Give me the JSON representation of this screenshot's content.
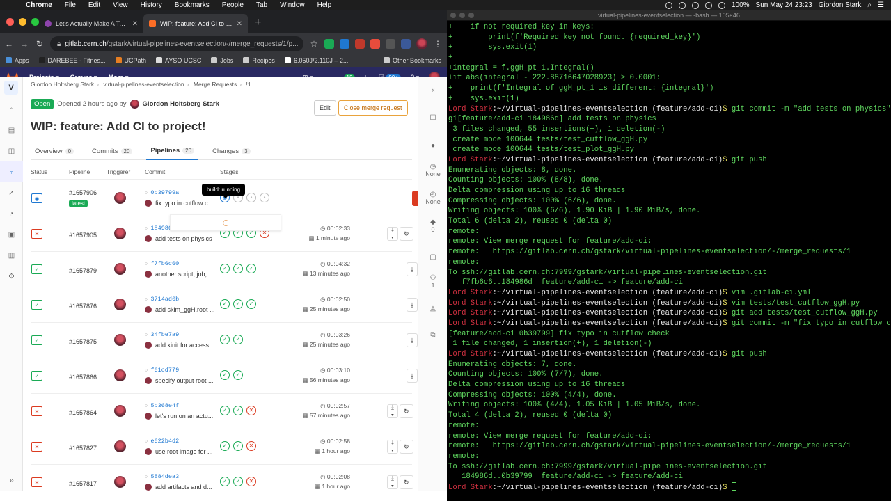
{
  "menubar": {
    "app": "Chrome",
    "items": [
      "File",
      "Edit",
      "View",
      "History",
      "Bookmarks",
      "People",
      "Tab",
      "Window",
      "Help"
    ],
    "battery": "100%",
    "datetime": "Sun May 24  23:23",
    "user": "Giordon Stark"
  },
  "browser": {
    "tabs": [
      {
        "title": "Let's Actually Make A Test (Fo...",
        "active": false
      },
      {
        "title": "WIP: feature: Add CI to project!",
        "active": true
      }
    ],
    "url_host": "gitlab.cern.ch",
    "url_path": "/gstark/virtual-pipelines-eventselection/-/merge_requests/1/p...",
    "bookmarks": [
      "Apps",
      "DAREBEE - Fitnes...",
      "UCPath",
      "AYSO UCSC",
      "Jobs",
      "Recipes",
      "6.050J/2.110J – 2..."
    ],
    "other_bookmarks": "Other Bookmarks"
  },
  "gitlab": {
    "nav": {
      "projects": "Projects",
      "groups": "Groups",
      "more": "More"
    },
    "nav_badges": {
      "mr": "12",
      "todo": "99+"
    },
    "project_letter": "V",
    "breadcrumb": [
      "Giordon Holtsberg Stark",
      "virtual-pipelines-eventselection",
      "Merge Requests",
      "!1"
    ],
    "mr": {
      "state": "Open",
      "opened": "Opened 2 hours ago by",
      "author": "Giordon Holtsberg Stark",
      "title": "WIP: feature: Add CI to project!",
      "edit": "Edit",
      "close": "Close merge request"
    },
    "tabs": [
      {
        "label": "Overview",
        "count": "0"
      },
      {
        "label": "Commits",
        "count": "20"
      },
      {
        "label": "Pipelines",
        "count": "20"
      },
      {
        "label": "Changes",
        "count": "3"
      }
    ],
    "columns": [
      "Status",
      "Pipeline",
      "Triggerer",
      "Commit",
      "Stages"
    ],
    "tooltip": "build: running",
    "pipelines": [
      {
        "status": "running",
        "id": "#1657906",
        "latest": "latest",
        "sha": "0b39799a",
        "message": "fix typo in cutflow c...",
        "stages": [
          "running",
          "created",
          "created",
          "created"
        ],
        "duration": "",
        "ago": ""
      },
      {
        "status": "failed",
        "id": "#1657905",
        "sha": "184986d8",
        "message": "add tests on physics",
        "stages": [
          "passed",
          "passed",
          "passed",
          "failed"
        ],
        "duration": "00:02:33",
        "ago": "1 minute ago"
      },
      {
        "status": "passed",
        "id": "#1657879",
        "sha": "f7fb6c60",
        "message": "another script, job, ...",
        "stages": [
          "passed",
          "passed",
          "passed"
        ],
        "duration": "00:04:32",
        "ago": "13 minutes ago"
      },
      {
        "status": "passed",
        "id": "#1657876",
        "sha": "3714ad6b",
        "message": "add skim_ggH.root ...",
        "stages": [
          "passed",
          "passed",
          "passed"
        ],
        "duration": "00:02:50",
        "ago": "25 minutes ago"
      },
      {
        "status": "passed",
        "id": "#1657875",
        "sha": "34fbe7a9",
        "message": "add kinit for access...",
        "stages": [
          "passed",
          "passed"
        ],
        "duration": "00:03:26",
        "ago": "25 minutes ago"
      },
      {
        "status": "passed",
        "id": "#1657866",
        "sha": "f61cd779",
        "message": "specify output root ...",
        "stages": [
          "passed",
          "passed"
        ],
        "duration": "00:03:10",
        "ago": "56 minutes ago"
      },
      {
        "status": "failed",
        "id": "#1657864",
        "sha": "5b368e4f",
        "message": "let's run on an actu...",
        "stages": [
          "passed",
          "passed",
          "failed"
        ],
        "duration": "00:02:57",
        "ago": "57 minutes ago"
      },
      {
        "status": "failed",
        "id": "#1657827",
        "sha": "e622b4d2",
        "message": "use root image for ...",
        "stages": [
          "passed",
          "passed",
          "failed"
        ],
        "duration": "00:02:58",
        "ago": "1 hour ago"
      },
      {
        "status": "failed",
        "id": "#1657817",
        "sha": "5884dea3",
        "message": "add artifacts and d...",
        "stages": [
          "passed",
          "passed",
          "failed"
        ],
        "duration": "00:02:08",
        "ago": "1 hour ago"
      }
    ],
    "right_sidebar": {
      "milestone": "None",
      "time": "None",
      "labels": "0",
      "participants": "1"
    }
  },
  "terminal": {
    "title": "virtual-pipelines-eventselection — -bash — 105×46",
    "lines": [
      {
        "segs": [
          [
            "g",
            "+    if not required_key in keys:"
          ]
        ]
      },
      {
        "segs": [
          [
            "g",
            "+        print(f'Required key not found. {required_key}')"
          ]
        ]
      },
      {
        "segs": [
          [
            "g",
            "+        sys.exit(1)"
          ]
        ]
      },
      {
        "segs": [
          [
            "g",
            "+"
          ]
        ]
      },
      {
        "segs": [
          [
            "g",
            "+integral = f.ggH_pt_1.Integral()"
          ]
        ]
      },
      {
        "segs": [
          [
            "g",
            "+if abs(integral - 222.88716647028923) > 0.0001:"
          ]
        ]
      },
      {
        "segs": [
          [
            "g",
            "+    print(f'Integral of ggH_pt_1 is different: {integral}')"
          ]
        ]
      },
      {
        "segs": [
          [
            "g",
            "+    sys.exit(1)"
          ]
        ]
      },
      {
        "segs": [
          [
            "r",
            "Lord Stark"
          ],
          [
            "w",
            ":~/virtual-pipelines-eventselection "
          ],
          [
            "w",
            "(feature/add-ci)"
          ],
          [
            "y",
            "$ "
          ],
          [
            "g",
            "git commit -m \"add tests on physics\""
          ]
        ]
      },
      {
        "segs": [
          [
            "g",
            "gi[feature/add-ci 184986d] add tests on physics"
          ]
        ]
      },
      {
        "segs": [
          [
            "g",
            " 3 files changed, 55 insertions(+), 1 deletion(-)"
          ]
        ]
      },
      {
        "segs": [
          [
            "g",
            " create mode 100644 tests/test_cutflow_ggH.py"
          ]
        ]
      },
      {
        "segs": [
          [
            "g",
            " create mode 100644 tests/test_plot_ggH.py"
          ]
        ]
      },
      {
        "segs": [
          [
            "r",
            "Lord Stark"
          ],
          [
            "w",
            ":~/virtual-pipelines-eventselection "
          ],
          [
            "w",
            "(feature/add-ci)"
          ],
          [
            "y",
            "$ "
          ],
          [
            "g",
            "git push"
          ]
        ]
      },
      {
        "segs": [
          [
            "g",
            "Enumerating objects: 8, done."
          ]
        ]
      },
      {
        "segs": [
          [
            "g",
            "Counting objects: 100% (8/8), done."
          ]
        ]
      },
      {
        "segs": [
          [
            "g",
            "Delta compression using up to 16 threads"
          ]
        ]
      },
      {
        "segs": [
          [
            "g",
            "Compressing objects: 100% (6/6), done."
          ]
        ]
      },
      {
        "segs": [
          [
            "g",
            "Writing objects: 100% (6/6), 1.90 KiB | 1.90 MiB/s, done."
          ]
        ]
      },
      {
        "segs": [
          [
            "g",
            "Total 6 (delta 2), reused 0 (delta 0)"
          ]
        ]
      },
      {
        "segs": [
          [
            "g",
            "remote:"
          ]
        ]
      },
      {
        "segs": [
          [
            "g",
            "remote: View merge request for feature/add-ci:"
          ]
        ]
      },
      {
        "segs": [
          [
            "g",
            "remote:   https://gitlab.cern.ch/gstark/virtual-pipelines-eventselection/-/merge_requests/1"
          ]
        ]
      },
      {
        "segs": [
          [
            "g",
            "remote:"
          ]
        ]
      },
      {
        "segs": [
          [
            "g",
            "To ssh://gitlab.cern.ch:7999/gstark/virtual-pipelines-eventselection.git"
          ]
        ]
      },
      {
        "segs": [
          [
            "g",
            "   f7fb6c6..184986d  feature/add-ci -> feature/add-ci"
          ]
        ]
      },
      {
        "segs": [
          [
            "r",
            "Lord Stark"
          ],
          [
            "w",
            ":~/virtual-pipelines-eventselection "
          ],
          [
            "w",
            "(feature/add-ci)"
          ],
          [
            "y",
            "$ "
          ],
          [
            "g",
            "vim .gitlab-ci.yml"
          ]
        ]
      },
      {
        "segs": [
          [
            "r",
            "Lord Stark"
          ],
          [
            "w",
            ":~/virtual-pipelines-eventselection "
          ],
          [
            "w",
            "(feature/add-ci)"
          ],
          [
            "y",
            "$ "
          ],
          [
            "g",
            "vim tests/test_cutflow_ggH.py"
          ]
        ]
      },
      {
        "segs": [
          [
            "r",
            "Lord Stark"
          ],
          [
            "w",
            ":~/virtual-pipelines-eventselection "
          ],
          [
            "w",
            "(feature/add-ci)"
          ],
          [
            "y",
            "$ "
          ],
          [
            "g",
            "git add tests/test_cutflow_ggH.py"
          ]
        ]
      },
      {
        "segs": [
          [
            "r",
            "Lord Stark"
          ],
          [
            "w",
            ":~/virtual-pipelines-eventselection "
          ],
          [
            "w",
            "(feature/add-ci)"
          ],
          [
            "y",
            "$ "
          ],
          [
            "g",
            "git commit -m \"fix typo in cutflow check\""
          ]
        ]
      },
      {
        "segs": [
          [
            "g",
            "[feature/add-ci 0b39799] fix typo in cutflow check"
          ]
        ]
      },
      {
        "segs": [
          [
            "g",
            " 1 file changed, 1 insertion(+), 1 deletion(-)"
          ]
        ]
      },
      {
        "segs": [
          [
            "r",
            "Lord Stark"
          ],
          [
            "w",
            ":~/virtual-pipelines-eventselection "
          ],
          [
            "w",
            "(feature/add-ci)"
          ],
          [
            "y",
            "$ "
          ],
          [
            "g",
            "git push"
          ]
        ]
      },
      {
        "segs": [
          [
            "g",
            "Enumerating objects: 7, done."
          ]
        ]
      },
      {
        "segs": [
          [
            "g",
            "Counting objects: 100% (7/7), done."
          ]
        ]
      },
      {
        "segs": [
          [
            "g",
            "Delta compression using up to 16 threads"
          ]
        ]
      },
      {
        "segs": [
          [
            "g",
            "Compressing objects: 100% (4/4), done."
          ]
        ]
      },
      {
        "segs": [
          [
            "g",
            "Writing objects: 100% (4/4), 1.05 KiB | 1.05 MiB/s, done."
          ]
        ]
      },
      {
        "segs": [
          [
            "g",
            "Total 4 (delta 2), reused 0 (delta 0)"
          ]
        ]
      },
      {
        "segs": [
          [
            "g",
            "remote:"
          ]
        ]
      },
      {
        "segs": [
          [
            "g",
            "remote: View merge request for feature/add-ci:"
          ]
        ]
      },
      {
        "segs": [
          [
            "g",
            "remote:   https://gitlab.cern.ch/gstark/virtual-pipelines-eventselection/-/merge_requests/1"
          ]
        ]
      },
      {
        "segs": [
          [
            "g",
            "remote:"
          ]
        ]
      },
      {
        "segs": [
          [
            "g",
            "To ssh://gitlab.cern.ch:7999/gstark/virtual-pipelines-eventselection.git"
          ]
        ]
      },
      {
        "segs": [
          [
            "g",
            "   184986d..0b39799  feature/add-ci -> feature/add-ci"
          ]
        ]
      },
      {
        "segs": [
          [
            "r",
            "Lord Stark"
          ],
          [
            "w",
            ":~/virtual-pipelines-eventselection "
          ],
          [
            "w",
            "(feature/add-ci)"
          ],
          [
            "y",
            "$ "
          ]
        ],
        "cursor": true
      }
    ]
  },
  "colors": {
    "gitlab_header": "#292961",
    "passed": "#1aaa55",
    "failed": "#db3b21",
    "running": "#1f78d1",
    "terminal_text": "#5fd75f"
  }
}
